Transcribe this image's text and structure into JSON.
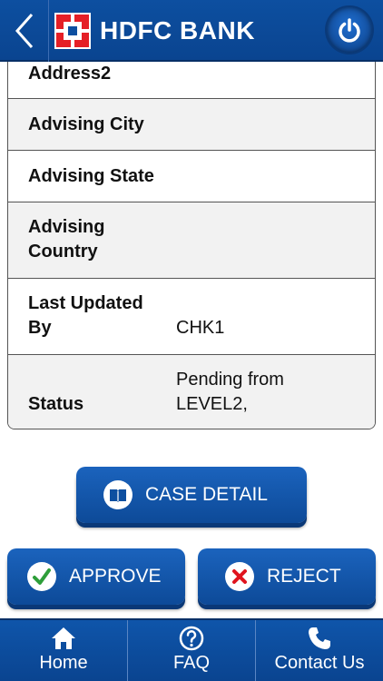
{
  "header": {
    "brand": "HDFC BANK",
    "back_icon": "chevron-left-icon",
    "power_icon": "power-icon"
  },
  "details": [
    {
      "label": "Address2",
      "value": ""
    },
    {
      "label": "Advising City",
      "value": ""
    },
    {
      "label": "Advising State",
      "value": ""
    },
    {
      "label": "Advising Country",
      "value": ""
    },
    {
      "label": "Last Updated By",
      "value": "CHK1"
    },
    {
      "label": "Status",
      "value": "Pending from LEVEL2,"
    }
  ],
  "labels": {
    "advising_country_1": "Advising",
    "advising_country_2": "Country",
    "last_updated_1": "Last Updated",
    "last_updated_2": "By",
    "status_1": "Pending from",
    "status_2": "LEVEL2,"
  },
  "actions": {
    "case_detail": "CASE DETAIL",
    "approve": "APPROVE",
    "reject": "REJECT"
  },
  "nav": {
    "home": "Home",
    "faq": "FAQ",
    "contact": "Contact Us"
  },
  "colors": {
    "primary": "#0d4fa0",
    "brand_red": "#e51f26",
    "approve_green": "#2e9e3a",
    "reject_red": "#e0141e"
  }
}
